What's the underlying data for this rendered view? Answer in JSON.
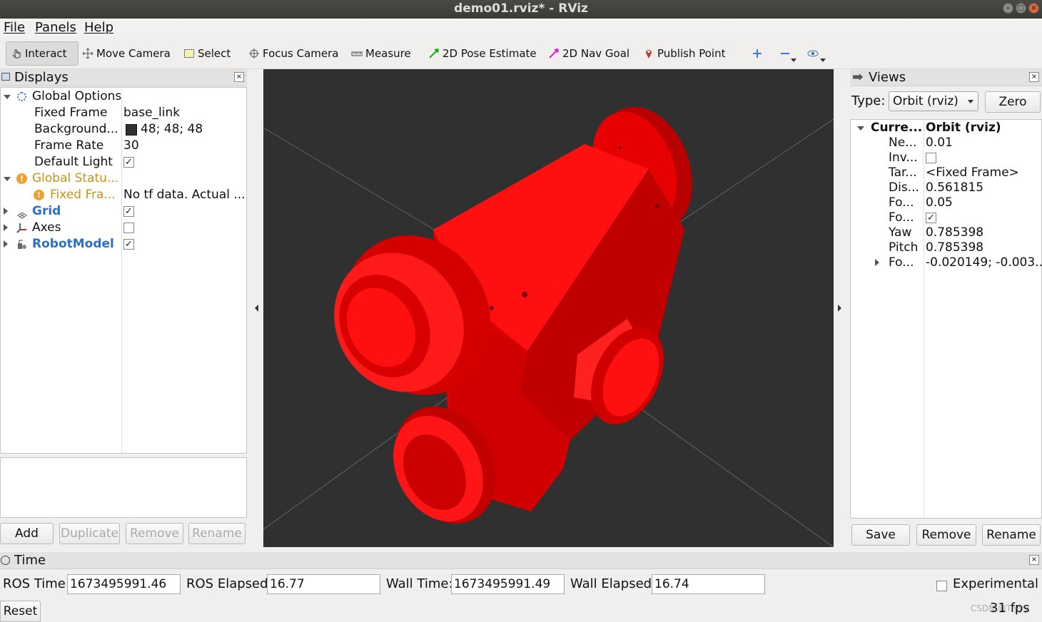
{
  "window": {
    "title": "demo01.rviz* - RViz"
  },
  "menu": [
    "File",
    "Panels",
    "Help"
  ],
  "toolbar": {
    "interact": "Interact",
    "move_camera": "Move Camera",
    "select": "Select",
    "focus_camera": "Focus Camera",
    "measure": "Measure",
    "pose_estimate": "2D Pose Estimate",
    "nav_goal": "2D Nav Goal",
    "publish_point": "Publish Point"
  },
  "displays": {
    "title": "Displays",
    "rows": {
      "global_options": "Global Options",
      "fixed_frame_label": "Fixed Frame",
      "fixed_frame_value": "base_link",
      "background_label": "Background...",
      "background_value": "48; 48; 48",
      "frame_rate_label": "Frame Rate",
      "frame_rate_value": "30",
      "default_light_label": "Default Light",
      "global_status": "Global Statu...",
      "fixed_frame_status": "Fixed Fra...",
      "fixed_frame_status_value": "No tf data.  Actual ...",
      "grid": "Grid",
      "axes": "Axes",
      "robot_model": "RobotModel"
    },
    "buttons": {
      "add": "Add",
      "duplicate": "Duplicate",
      "remove": "Remove",
      "rename": "Rename"
    }
  },
  "views": {
    "title": "Views",
    "type_label": "Type:",
    "type_value": "Orbit (rviz)",
    "zero": "Zero",
    "current_label": "Curre...",
    "current_value": "Orbit (rviz)",
    "props": [
      {
        "label": "Ne...",
        "value": "0.01"
      },
      {
        "label": "Inv...",
        "value": ""
      },
      {
        "label": "Tar...",
        "value": "<Fixed Frame>"
      },
      {
        "label": "Dis...",
        "value": "0.561815"
      },
      {
        "label": "Fo...",
        "value": "0.05"
      },
      {
        "label": "Fo...",
        "value": ""
      },
      {
        "label": "Yaw",
        "value": "0.785398"
      },
      {
        "label": "Pitch",
        "value": "0.785398"
      },
      {
        "label": "Fo...",
        "value": "-0.020149; -0.003..."
      }
    ],
    "buttons": {
      "save": "Save",
      "remove": "Remove",
      "rename": "Rename"
    }
  },
  "time": {
    "title": "Time",
    "ros_time_label": "ROS Time:",
    "ros_time": "1673495991.46",
    "ros_elapsed_label": "ROS Elapsed:",
    "ros_elapsed": "16.77",
    "wall_time_label": "Wall Time:",
    "wall_time": "1673495991.49",
    "wall_elapsed_label": "Wall Elapsed:",
    "wall_elapsed": "16.74",
    "experimental": "Experimental",
    "reset": "Reset",
    "fps": "31 fps",
    "watermark": "CSDN @Tiyyy"
  },
  "colors": {
    "viewport_bg": "#303030",
    "robot": "#e50000",
    "accent": "#3a7bd5"
  }
}
